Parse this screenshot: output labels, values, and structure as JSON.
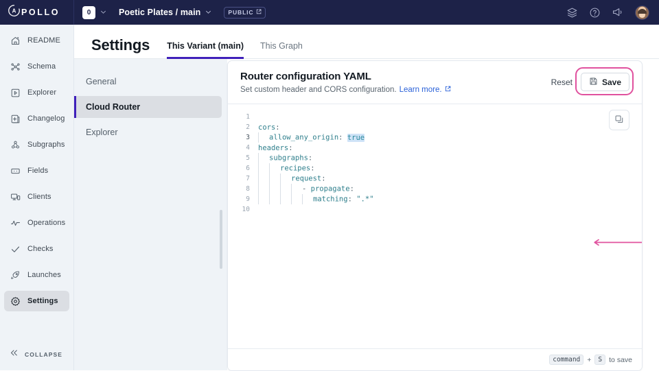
{
  "topbar": {
    "logo_text": "POLLO",
    "logo_icon": "apollo-logo-icon",
    "org_badge": "0",
    "org_chevron_icon": "chevron-down-icon",
    "graph_name": "Poetic Plates / main",
    "graph_chevron_icon": "chevron-down-icon",
    "visibility_badge": "PUBLIC",
    "visibility_link_icon": "external-link-icon",
    "icons": [
      "layers-icon",
      "help-circle-icon",
      "megaphone-icon",
      "avatar"
    ]
  },
  "sidebar": {
    "items": [
      {
        "label": "README",
        "icon": "readme-icon",
        "active": false
      },
      {
        "label": "Schema",
        "icon": "schema-icon",
        "active": false
      },
      {
        "label": "Explorer",
        "icon": "explorer-icon",
        "active": false
      },
      {
        "label": "Changelog",
        "icon": "changelog-icon",
        "active": false
      },
      {
        "label": "Subgraphs",
        "icon": "subgraphs-icon",
        "active": false
      },
      {
        "label": "Fields",
        "icon": "fields-icon",
        "active": false
      },
      {
        "label": "Clients",
        "icon": "clients-icon",
        "active": false
      },
      {
        "label": "Operations",
        "icon": "operations-icon",
        "active": false
      },
      {
        "label": "Checks",
        "icon": "checks-icon",
        "active": false
      },
      {
        "label": "Launches",
        "icon": "launches-icon",
        "active": false
      },
      {
        "label": "Settings",
        "icon": "gear-icon",
        "active": true
      }
    ],
    "collapse_label": "COLLAPSE",
    "collapse_icon": "double-chevron-left-icon"
  },
  "page": {
    "title": "Settings",
    "tabs": [
      {
        "label": "This Variant (main)",
        "active": true
      },
      {
        "label": "This Graph",
        "active": false
      }
    ]
  },
  "subnav": {
    "items": [
      {
        "label": "General",
        "active": false
      },
      {
        "label": "Cloud Router",
        "active": true
      },
      {
        "label": "Explorer",
        "active": false
      }
    ]
  },
  "card": {
    "title": "Router configuration YAML",
    "subtitle": "Set custom header and CORS configuration.",
    "learn_more": "Learn more.",
    "learn_more_icon": "external-link-icon",
    "reset_label": "Reset",
    "save_label": "Save",
    "save_icon": "floppy-disk-icon",
    "copy_icon": "copy-icon",
    "footer_prefix": "",
    "footer_key_command": "command",
    "footer_plus": "+",
    "footer_key_s": "S",
    "footer_suffix": "to save"
  },
  "editor": {
    "lines": [
      {
        "num": "1",
        "indent": 0,
        "text": ""
      },
      {
        "num": "2",
        "indent": 0,
        "text": "cors:"
      },
      {
        "num": "3",
        "indent": 1,
        "text": "allow_any_origin: true",
        "current": true
      },
      {
        "num": "4",
        "indent": 0,
        "text": "headers:"
      },
      {
        "num": "5",
        "indent": 1,
        "text": "subgraphs:"
      },
      {
        "num": "6",
        "indent": 2,
        "text": "recipes:"
      },
      {
        "num": "7",
        "indent": 3,
        "text": "request:"
      },
      {
        "num": "8",
        "indent": 4,
        "text": "- propagate:"
      },
      {
        "num": "9",
        "indent": 5,
        "text": "matching: \".*\""
      },
      {
        "num": "10",
        "indent": 0,
        "text": ""
      }
    ],
    "selected_token": "true",
    "annotation": "pink-arrow-pointing-to-true"
  },
  "colors": {
    "topbar_bg": "#1d2248",
    "sidebar_bg": "#eff3f7",
    "accent_blue": "#3f20ba",
    "link_blue": "#2a61d8",
    "annotation_pink": "#e0519e",
    "code_teal": "#2f7f8c",
    "selection_blue": "#cfe3f7"
  }
}
